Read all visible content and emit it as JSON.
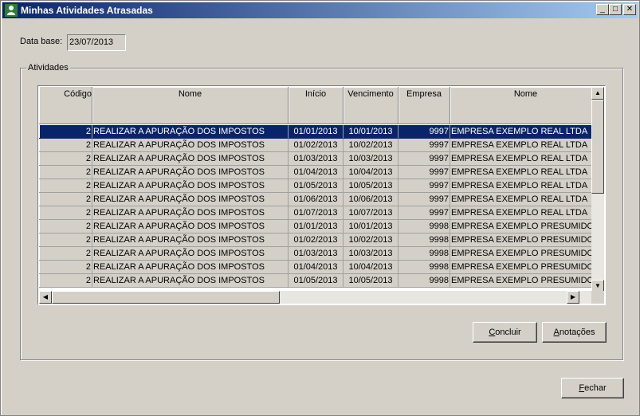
{
  "window": {
    "title": "Minhas Atividades Atrasadas",
    "min_symbol": "_",
    "max_symbol": "□",
    "close_symbol": "✕"
  },
  "date_base": {
    "label": "Data base:",
    "value": "23/07/2013"
  },
  "group": {
    "title": "Atividades"
  },
  "table": {
    "columns": [
      "Código",
      "Nome",
      "Início",
      "Vencimento",
      "Empresa",
      "Nome"
    ],
    "rows": [
      [
        "2",
        "REALIZAR A APURAÇÃO DOS IMPOSTOS",
        "01/01/2013",
        "10/01/2013",
        "9997",
        "EMPRESA EXEMPLO REAL LTDA"
      ],
      [
        "2",
        "REALIZAR A APURAÇÃO DOS IMPOSTOS",
        "01/02/2013",
        "10/02/2013",
        "9997",
        "EMPRESA EXEMPLO REAL LTDA"
      ],
      [
        "2",
        "REALIZAR A APURAÇÃO DOS IMPOSTOS",
        "01/03/2013",
        "10/03/2013",
        "9997",
        "EMPRESA EXEMPLO REAL LTDA"
      ],
      [
        "2",
        "REALIZAR A APURAÇÃO DOS IMPOSTOS",
        "01/04/2013",
        "10/04/2013",
        "9997",
        "EMPRESA EXEMPLO REAL LTDA"
      ],
      [
        "2",
        "REALIZAR A APURAÇÃO DOS IMPOSTOS",
        "01/05/2013",
        "10/05/2013",
        "9997",
        "EMPRESA EXEMPLO REAL LTDA"
      ],
      [
        "2",
        "REALIZAR A APURAÇÃO DOS IMPOSTOS",
        "01/06/2013",
        "10/06/2013",
        "9997",
        "EMPRESA EXEMPLO REAL LTDA"
      ],
      [
        "2",
        "REALIZAR A APURAÇÃO DOS IMPOSTOS",
        "01/07/2013",
        "10/07/2013",
        "9997",
        "EMPRESA EXEMPLO REAL LTDA"
      ],
      [
        "2",
        "REALIZAR A APURAÇÃO DOS IMPOSTOS",
        "01/01/2013",
        "10/01/2013",
        "9998",
        "EMPRESA EXEMPLO PRESUMIDO"
      ],
      [
        "2",
        "REALIZAR A APURAÇÃO DOS IMPOSTOS",
        "01/02/2013",
        "10/02/2013",
        "9998",
        "EMPRESA EXEMPLO PRESUMIDO"
      ],
      [
        "2",
        "REALIZAR A APURAÇÃO DOS IMPOSTOS",
        "01/03/2013",
        "10/03/2013",
        "9998",
        "EMPRESA EXEMPLO PRESUMIDO"
      ],
      [
        "2",
        "REALIZAR A APURAÇÃO DOS IMPOSTOS",
        "01/04/2013",
        "10/04/2013",
        "9998",
        "EMPRESA EXEMPLO PRESUMIDO"
      ],
      [
        "2",
        "REALIZAR A APURAÇÃO DOS IMPOSTOS",
        "01/05/2013",
        "10/05/2013",
        "9998",
        "EMPRESA EXEMPLO PRESUMIDO"
      ]
    ],
    "selected_row": 0
  },
  "buttons": {
    "concluir_pre": "",
    "concluir_u": "C",
    "concluir_post": "oncluir",
    "anotacoes_pre": "",
    "anotacoes_u": "A",
    "anotacoes_post": "notações",
    "fechar_pre": "",
    "fechar_u": "F",
    "fechar_post": "echar"
  },
  "colors": {
    "selection": "#0a246a",
    "face": "#d4d0c8",
    "title_gradient_start": "#0a246a",
    "title_gradient_end": "#a6caf0"
  }
}
